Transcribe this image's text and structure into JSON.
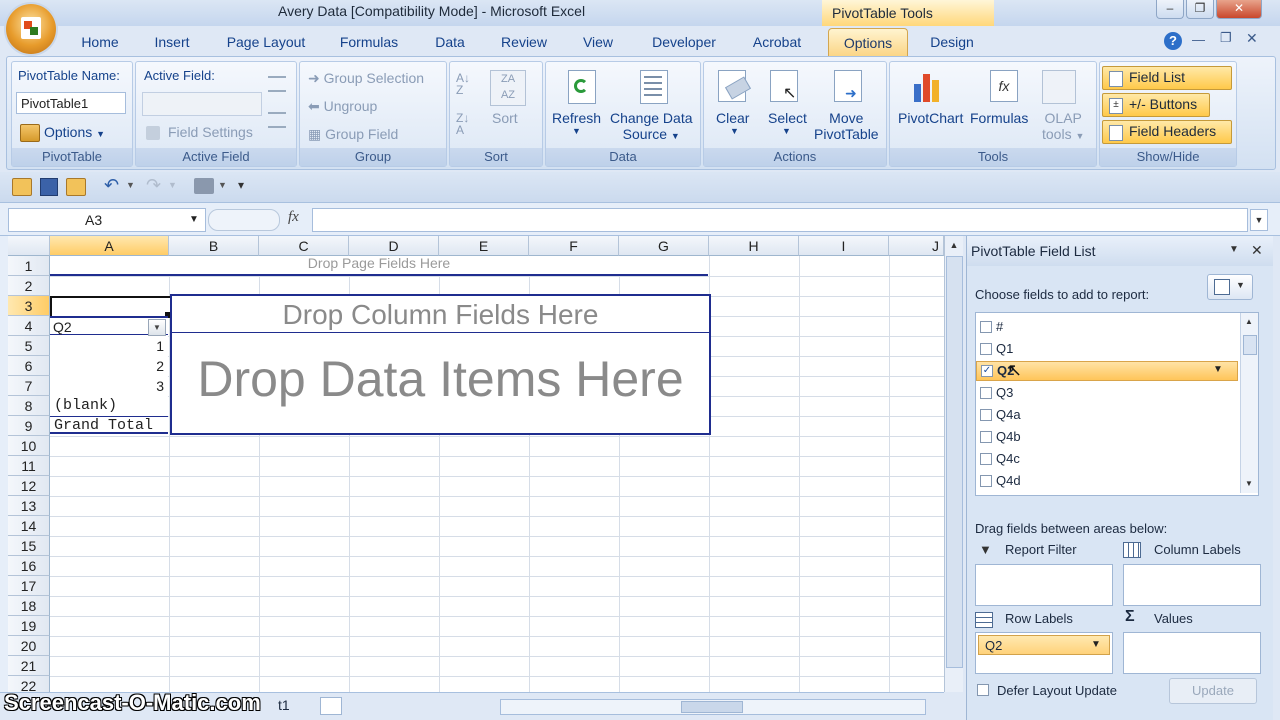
{
  "window": {
    "title": "Avery Data  [Compatibility Mode] - Microsoft Excel",
    "contextual_tab": "PivotTable Tools",
    "minimize_label": "–",
    "restore_label": "❐",
    "close_label": "✕"
  },
  "tabs": [
    "Home",
    "Insert",
    "Page Layout",
    "Formulas",
    "Data",
    "Review",
    "View",
    "Developer",
    "Acrobat",
    "Options",
    "Design"
  ],
  "active_tab": "Options",
  "ribbon": {
    "pivottable": {
      "name_label": "PivotTable Name:",
      "name_value": "PivotTable1",
      "options_label": "Options",
      "group_label": "PivotTable"
    },
    "active_field": {
      "label": "Active Field:",
      "field_settings": "Field Settings",
      "group_label": "Active Field"
    },
    "group": {
      "group_selection": "Group Selection",
      "ungroup": "Ungroup",
      "group_field": "Group Field",
      "group_label": "Group"
    },
    "sort": {
      "sort_label": "Sort",
      "group_label": "Sort"
    },
    "data": {
      "refresh": "Refresh",
      "change_source_1": "Change Data",
      "change_source_2": "Source",
      "group_label": "Data"
    },
    "actions": {
      "clear": "Clear",
      "select": "Select",
      "move_1": "Move",
      "move_2": "PivotTable",
      "group_label": "Actions"
    },
    "tools": {
      "pivotchart": "PivotChart",
      "formulas": "Formulas",
      "olap_1": "OLAP",
      "olap_2": "tools",
      "group_label": "Tools"
    },
    "show_hide": {
      "field_list": "Field List",
      "buttons": "+/- Buttons",
      "field_headers": "Field Headers",
      "group_label": "Show/Hide"
    }
  },
  "formula_bar": {
    "name_box": "A3",
    "fx": "fx",
    "value": ""
  },
  "sheet": {
    "columns": [
      "A",
      "B",
      "C",
      "D",
      "E",
      "F",
      "G",
      "H",
      "I",
      "J"
    ],
    "rows": [
      "1",
      "2",
      "3",
      "4",
      "5",
      "6",
      "7",
      "8",
      "9",
      "10",
      "11",
      "12",
      "13",
      "14",
      "15",
      "16",
      "17",
      "18",
      "19",
      "20",
      "21",
      "22"
    ],
    "drop_page": "Drop Page Fields Here",
    "drop_column": "Drop Column Fields Here",
    "drop_data": "Drop Data Items Here",
    "row_field": "Q2",
    "row_items": [
      "1",
      "2",
      "3"
    ],
    "blank": "(blank)",
    "grand_total": "Grand Total",
    "sheet_tab_partial": "t1"
  },
  "field_list": {
    "title": "PivotTable Field List",
    "choose_label": "Choose fields to add to report:",
    "fields": [
      {
        "name": "#",
        "checked": false
      },
      {
        "name": "Q1",
        "checked": false
      },
      {
        "name": "Q2",
        "checked": true
      },
      {
        "name": "Q3",
        "checked": false
      },
      {
        "name": "Q4a",
        "checked": false
      },
      {
        "name": "Q4b",
        "checked": false
      },
      {
        "name": "Q4c",
        "checked": false
      },
      {
        "name": "Q4d",
        "checked": false
      }
    ],
    "drag_label": "Drag fields between areas below:",
    "report_filter": "Report Filter",
    "column_labels": "Column Labels",
    "row_labels": "Row Labels",
    "values": "Values",
    "row_item": "Q2",
    "defer_label": "Defer Layout Update",
    "update_button": "Update"
  },
  "watermark": "Screencast-O-Matic.com",
  "colors": {
    "accent_tab": "#fbd483",
    "ribbon_bg": "#dce7f5",
    "pivot_border": "#1f2d8f",
    "highlight": "#ffc94a"
  }
}
